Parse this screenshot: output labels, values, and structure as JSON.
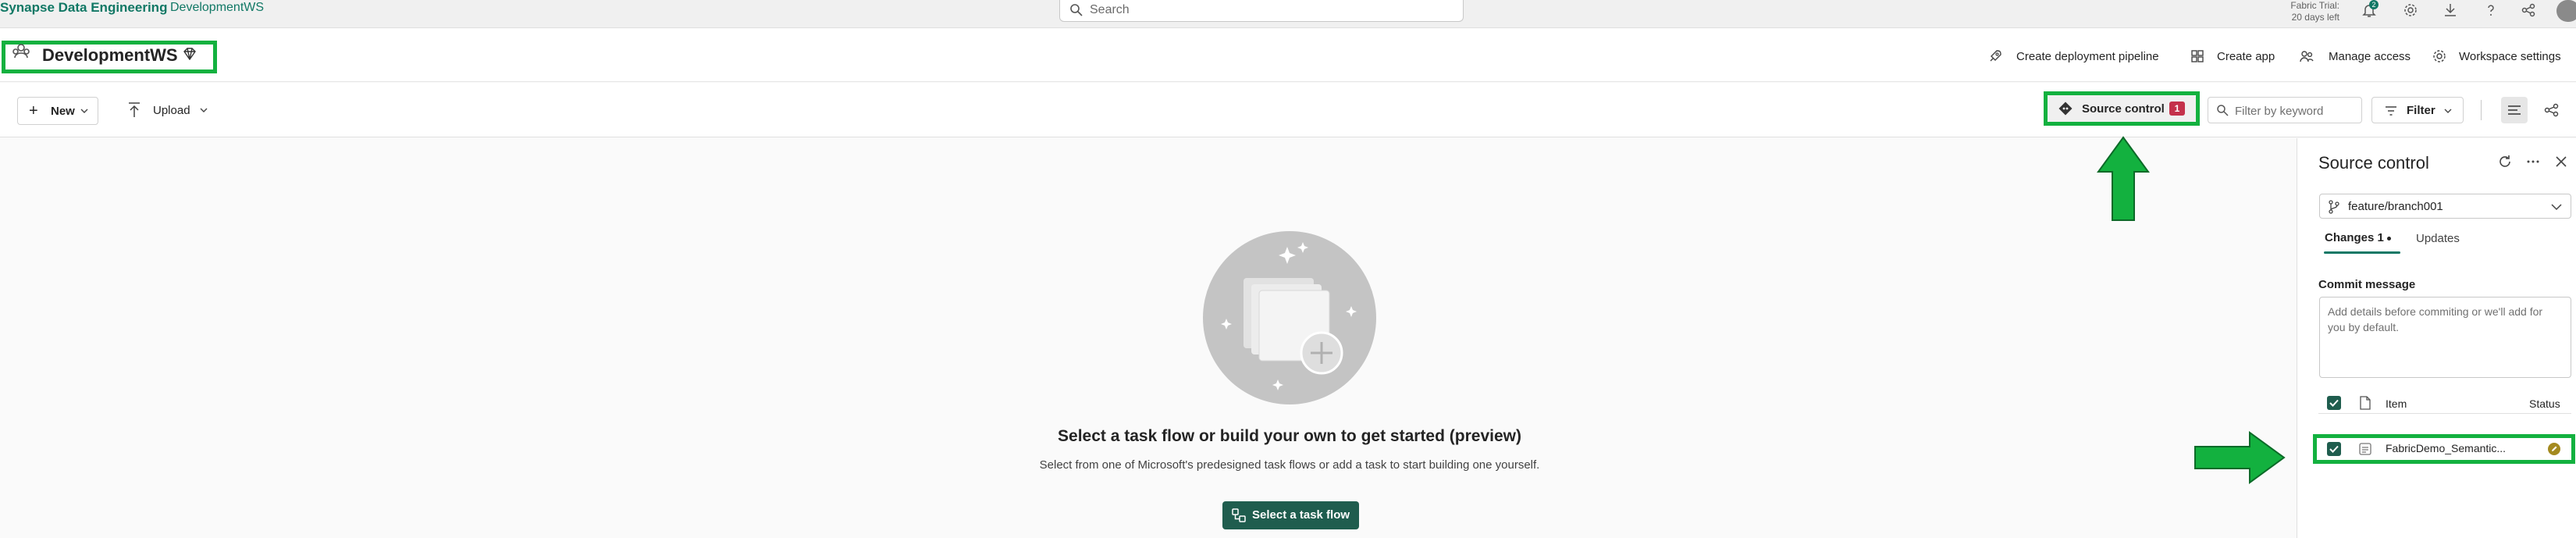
{
  "topbar": {
    "brand": "Synapse Data Engineering",
    "workspace_crumb": "DevelopmentWS",
    "search_placeholder": "Search",
    "trial_line1": "Fabric Trial:",
    "trial_line2": "20 days left",
    "notification_count": "2",
    "icons": [
      "bell-icon",
      "gear-icon",
      "download-icon",
      "help-icon",
      "share-icon",
      "avatar"
    ]
  },
  "workspace": {
    "name": "DevelopmentWS",
    "actions": [
      {
        "label": "Create deployment pipeline",
        "icon": "rocket-icon"
      },
      {
        "label": "Create app",
        "icon": "apps-icon"
      },
      {
        "label": "Manage access",
        "icon": "people-icon"
      },
      {
        "label": "Workspace settings",
        "icon": "gear-icon"
      }
    ]
  },
  "toolbar": {
    "new_label": "New",
    "upload_label": "Upload",
    "source_control_label": "Source control",
    "source_control_count": "1",
    "filter_placeholder": "Filter by keyword",
    "filter_label": "Filter"
  },
  "main": {
    "empty_title": "Select a task flow or build your own to get started (preview)",
    "empty_subtitle": "Select from one of Microsoft's predesigned task flows or add a task to start building one yourself.",
    "task_flow_button": "Select a task flow"
  },
  "panel": {
    "title": "Source control",
    "branch": "feature/branch001",
    "tab_changes": "Changes 1",
    "tab_updates": "Updates",
    "commit_label": "Commit message",
    "commit_placeholder": "Add details before commiting or we'll add for you by default.",
    "col_item": "Item",
    "col_status": "Status",
    "rows": [
      {
        "name": "FabricDemo_Semantic...",
        "status": "modified"
      }
    ]
  },
  "colors": {
    "accent": "#117865",
    "highlight_box": "#13b13f",
    "badge_red": "#c4314b",
    "primary_button": "#1f5d4e"
  }
}
